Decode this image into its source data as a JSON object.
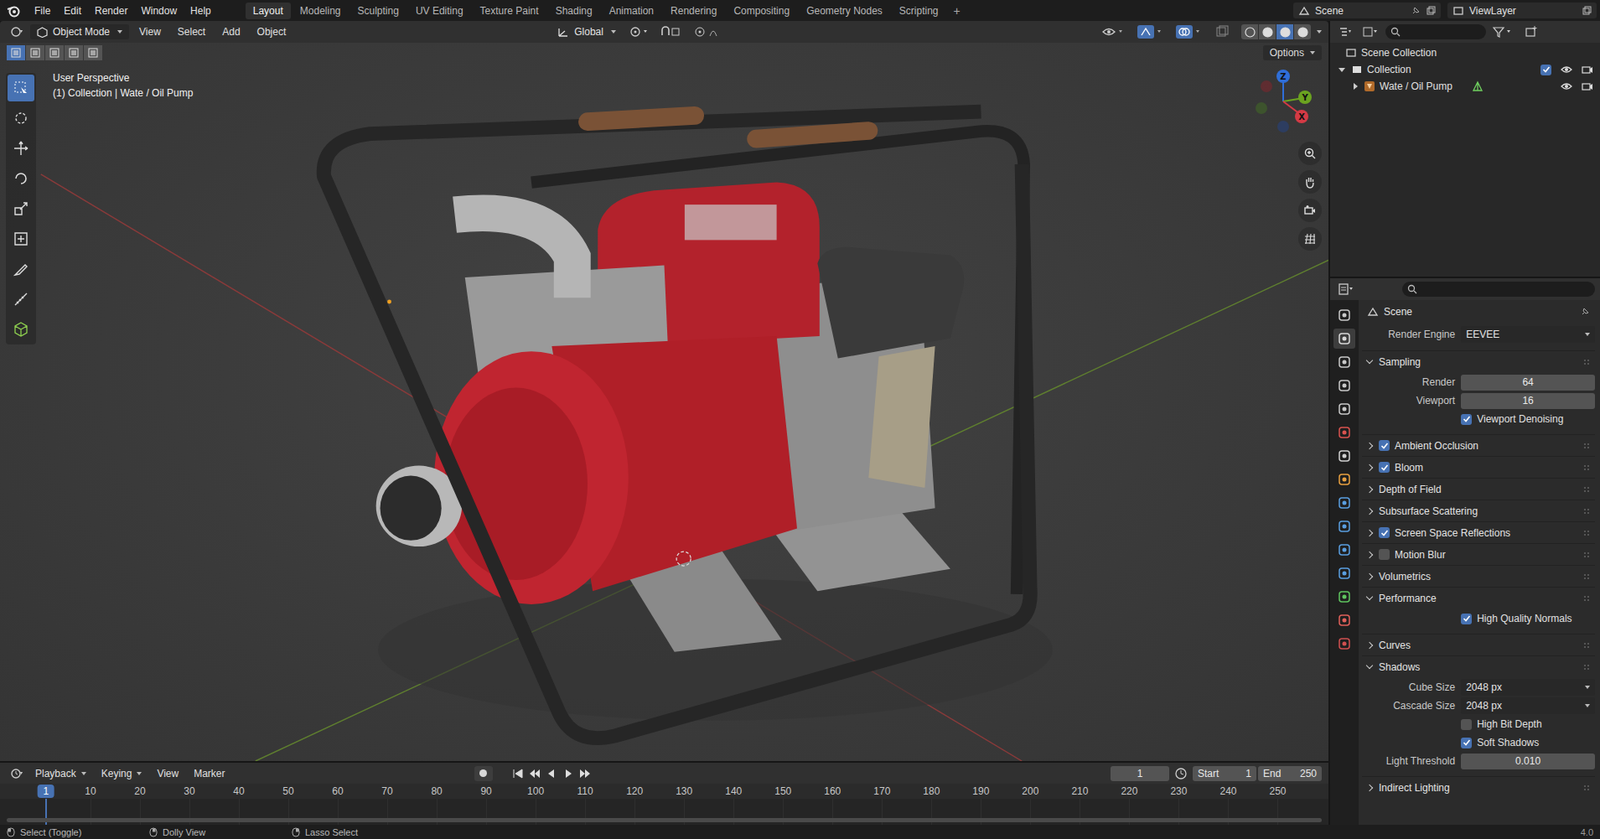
{
  "window": {
    "title": "Blender"
  },
  "top_menu": [
    "File",
    "Edit",
    "Render",
    "Window",
    "Help"
  ],
  "workspaces": [
    {
      "label": "Layout",
      "selected": true
    },
    {
      "label": "Modeling",
      "selected": false
    },
    {
      "label": "Sculpting",
      "selected": false
    },
    {
      "label": "UV Editing",
      "selected": false
    },
    {
      "label": "Texture Paint",
      "selected": false
    },
    {
      "label": "Shading",
      "selected": false
    },
    {
      "label": "Animation",
      "selected": false
    },
    {
      "label": "Rendering",
      "selected": false
    },
    {
      "label": "Compositing",
      "selected": false
    },
    {
      "label": "Geometry Nodes",
      "selected": false
    },
    {
      "label": "Scripting",
      "selected": false
    }
  ],
  "add_workspace": "+",
  "scene_field": "Scene",
  "view_layer_field": "ViewLayer",
  "viewport": {
    "mode": "Object Mode",
    "menus": [
      "View",
      "Select",
      "Add",
      "Object"
    ],
    "orientation": "Global",
    "options": "Options",
    "perspective": "User Perspective",
    "context": "(1) Collection | Wate / Oil  Pump",
    "select_modes": [
      {
        "selected": true
      },
      {
        "selected": false
      },
      {
        "selected": false
      },
      {
        "selected": false
      },
      {
        "selected": false
      }
    ],
    "tools": [
      {
        "selected": true
      },
      {
        "selected": false
      },
      {
        "selected": false
      },
      {
        "selected": false
      },
      {
        "selected": false
      },
      {
        "selected": false
      },
      {
        "selected": false
      },
      {
        "selected": false
      },
      {
        "selected": false
      }
    ],
    "axes": [
      {
        "label": "Z",
        "color": "#2f6ed8"
      },
      {
        "label": "Y",
        "color": "#6ba320"
      },
      {
        "label": "X",
        "color": "#d43a45"
      }
    ],
    "shading_modes": [
      {
        "selected": false
      },
      {
        "selected": false
      },
      {
        "selected": true
      },
      {
        "selected": false
      }
    ]
  },
  "outliner": {
    "root": "Scene Collection",
    "collection": {
      "label": "Collection",
      "expanded": true,
      "checked": true
    },
    "object": {
      "label": "Wate / Oil  Pump",
      "expanded": false
    }
  },
  "properties": {
    "tabs": [
      {
        "selected": false,
        "color": "#c8c8c8"
      },
      {
        "selected": true,
        "color": "#d8d8d8"
      },
      {
        "selected": false,
        "color": "#c8c8c8"
      },
      {
        "selected": false,
        "color": "#c8c8c8"
      },
      {
        "selected": false,
        "color": "#c8c8c8"
      },
      {
        "selected": false,
        "color": "#d9534f"
      },
      {
        "selected": false,
        "color": "#d0d0d0"
      },
      {
        "selected": false,
        "color": "#e8a040"
      },
      {
        "selected": false,
        "color": "#5a9ee0"
      },
      {
        "selected": false,
        "color": "#5a9ee0"
      },
      {
        "selected": false,
        "color": "#5a9ee0"
      },
      {
        "selected": false,
        "color": "#5a9ee0"
      },
      {
        "selected": false,
        "color": "#5fc45f"
      },
      {
        "selected": false,
        "color": "#e0605a"
      },
      {
        "selected": false,
        "color": "#d05050"
      }
    ],
    "context": "Scene",
    "render_engine": {
      "label": "Render Engine",
      "value": "EEVEE"
    },
    "panels": [
      {
        "label": "Sampling",
        "kind": "plain",
        "checked": false,
        "expanded": true,
        "rows": [
          {
            "kind": "number",
            "label": "Render",
            "value": "64"
          },
          {
            "kind": "number",
            "label": "Viewport",
            "value": "16"
          },
          {
            "kind": "checkbox",
            "label": "Viewport Denoising",
            "checked": true
          }
        ]
      },
      {
        "label": "Ambient Occlusion",
        "kind": "toggle",
        "checked": true,
        "expanded": false,
        "rows": []
      },
      {
        "label": "Bloom",
        "kind": "toggle",
        "checked": true,
        "expanded": false,
        "rows": []
      },
      {
        "label": "Depth of Field",
        "kind": "plain",
        "checked": false,
        "expanded": false,
        "rows": []
      },
      {
        "label": "Subsurface Scattering",
        "kind": "plain",
        "checked": false,
        "expanded": false,
        "rows": []
      },
      {
        "label": "Screen Space Reflections",
        "kind": "toggle",
        "checked": true,
        "expanded": false,
        "rows": []
      },
      {
        "label": "Motion Blur",
        "kind": "toggle",
        "checked": false,
        "expanded": false,
        "rows": []
      },
      {
        "label": "Volumetrics",
        "kind": "plain",
        "checked": false,
        "expanded": false,
        "rows": []
      },
      {
        "label": "Performance",
        "kind": "plain",
        "checked": false,
        "expanded": true,
        "rows": [
          {
            "kind": "checkbox",
            "label": "High Quality Normals",
            "checked": true
          }
        ]
      },
      {
        "label": "Curves",
        "kind": "plain",
        "checked": false,
        "expanded": false,
        "rows": []
      },
      {
        "label": "Shadows",
        "kind": "plain",
        "checked": false,
        "expanded": true,
        "rows": [
          {
            "kind": "select",
            "label": "Cube Size",
            "value": "2048 px"
          },
          {
            "kind": "select",
            "label": "Cascade Size",
            "value": "2048 px"
          },
          {
            "kind": "checkbox",
            "label": "High Bit Depth",
            "checked": false
          },
          {
            "kind": "checkbox",
            "label": "Soft Shadows",
            "checked": true
          },
          {
            "kind": "number",
            "label": "Light Threshold",
            "value": "0.010"
          }
        ]
      },
      {
        "label": "Indirect Lighting",
        "kind": "plain",
        "checked": false,
        "expanded": false,
        "rows": []
      }
    ]
  },
  "timeline": {
    "menus": [
      "Playback",
      "Keying",
      "View",
      "Marker"
    ],
    "current_frame": "1",
    "start_label": "Start",
    "start": "1",
    "end_label": "End",
    "end": "250",
    "ticks": [
      "1",
      "10",
      "20",
      "30",
      "40",
      "50",
      "60",
      "70",
      "80",
      "90",
      "100",
      "110",
      "120",
      "130",
      "140",
      "150",
      "160",
      "170",
      "180",
      "190",
      "200",
      "210",
      "220",
      "230",
      "240",
      "250"
    ]
  },
  "status_bar": {
    "items": [
      "Select (Toggle)",
      "Dolly View",
      "Lasso Select"
    ],
    "version": "4.0"
  }
}
